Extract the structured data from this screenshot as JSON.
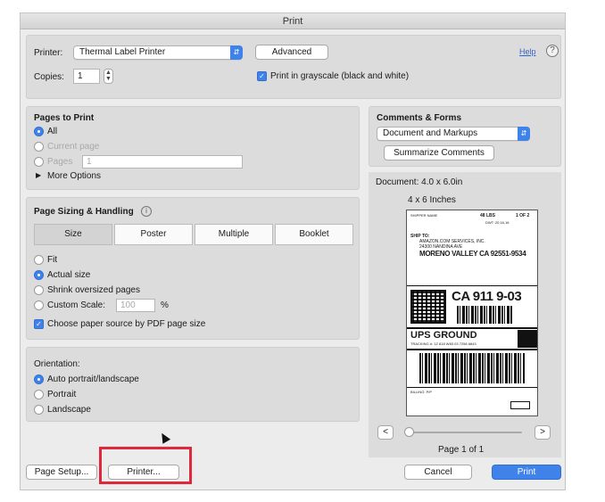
{
  "window": {
    "title": "Print"
  },
  "printer": {
    "label": "Printer:",
    "selected": "Thermal Label Printer",
    "advanced_label": "Advanced",
    "help_link": "Help",
    "copies_label": "Copies:",
    "copies_value": "1",
    "grayscale_label": "Print in grayscale (black and white)",
    "grayscale_checked": true
  },
  "pages_to_print": {
    "title": "Pages to Print",
    "options": [
      {
        "label": "All",
        "selected": true
      },
      {
        "label": "Current page",
        "selected": false
      },
      {
        "label": "Pages",
        "selected": false
      }
    ],
    "pages_value": "1",
    "more_options": "More Options"
  },
  "sizing": {
    "title": "Page Sizing & Handling",
    "tabs": [
      "Size",
      "Poster",
      "Multiple",
      "Booklet"
    ],
    "active_tab": "Size",
    "options": [
      {
        "label": "Fit",
        "selected": false
      },
      {
        "label": "Actual size",
        "selected": true
      },
      {
        "label": "Shrink oversized pages",
        "selected": false
      },
      {
        "label": "Custom Scale:",
        "selected": false
      }
    ],
    "custom_scale_value": "100",
    "percent": "%",
    "paper_source_label": "Choose paper source by PDF page size",
    "paper_source_checked": true
  },
  "orientation": {
    "title": "Orientation:",
    "options": [
      {
        "label": "Auto portrait/landscape",
        "selected": true
      },
      {
        "label": "Portrait",
        "selected": false
      },
      {
        "label": "Landscape",
        "selected": false
      }
    ]
  },
  "comments_forms": {
    "title": "Comments & Forms",
    "selected": "Document and Markups",
    "summarize_label": "Summarize Comments"
  },
  "preview": {
    "document_size": "Document: 4.0 x 6.0in",
    "page_size_label": "4 x 6 Inches",
    "page_counter": "Page 1 of 1",
    "prev": "<",
    "next": ">"
  },
  "shipping_label": {
    "header_left": "SHIPPER NAME",
    "weight": "48 LBS",
    "count": "1 OF 2",
    "dwt": "DWT: 20,16,16",
    "ship_to_label": "SHIP TO:",
    "ship_to_company": "AMAZON.COM SERVICES, INC.",
    "ship_to_street": "24300 NANDINA AVE",
    "ship_to_city": "MORENO VALLEY CA 92551-9534",
    "routing": "CA 911 9-03",
    "service": "UPS GROUND",
    "tracking": "TRACKING #: 1Z 818 W83 03 7258 6843",
    "billing": "BILLING: P/P"
  },
  "footer": {
    "page_setup": "Page Setup...",
    "printer": "Printer...",
    "cancel": "Cancel",
    "print": "Print"
  }
}
